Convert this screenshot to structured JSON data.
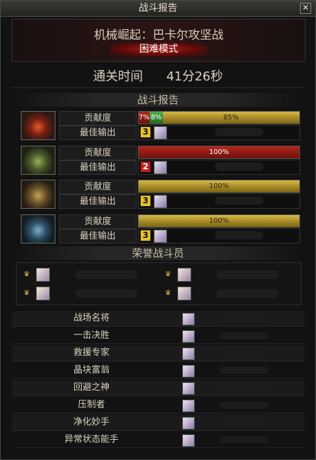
{
  "window": {
    "title": "战斗报告",
    "close_glyph": "✕"
  },
  "dungeon": {
    "name": "机械崛起：巴卡尔攻坚战",
    "mode": "困难模式"
  },
  "clear_time": {
    "label": "通关时间",
    "value": "41分26秒"
  },
  "report": {
    "section_title": "战斗报告",
    "contribution_label": "贡献度",
    "best_output_label": "最佳输出",
    "players": [
      {
        "portrait": "red-warrior-icon",
        "contribution": [
          {
            "value": "7%",
            "pct": 7,
            "color": "#b3261e"
          },
          {
            "value": "8%",
            "pct": 8,
            "color": "#4caf50"
          },
          {
            "value": "85%",
            "pct": 85,
            "color": "#c9a93a"
          }
        ],
        "best_rank": "3"
      },
      {
        "portrait": "green-warrior-icon",
        "contribution": [
          {
            "value": "100%",
            "pct": 100,
            "color": "#b3261e"
          }
        ],
        "best_rank": "2"
      },
      {
        "portrait": "gold-warrior-icon",
        "contribution": [
          {
            "value": "100%",
            "pct": 100,
            "color": "#c9a93a"
          }
        ],
        "best_rank": "3"
      },
      {
        "portrait": "blue-warrior-icon",
        "contribution": [
          {
            "value": "100%",
            "pct": 100,
            "color": "#c9a93a"
          }
        ],
        "best_rank": "3"
      }
    ]
  },
  "honor": {
    "section_title": "荣誉战斗员"
  },
  "awards": [
    {
      "name": "战场名将"
    },
    {
      "name": "一击决胜"
    },
    {
      "name": "救援专家"
    },
    {
      "name": "晶块富翁"
    },
    {
      "name": "回避之神"
    },
    {
      "name": "压制者"
    },
    {
      "name": "净化妙手"
    },
    {
      "name": "异常状态能手"
    }
  ]
}
